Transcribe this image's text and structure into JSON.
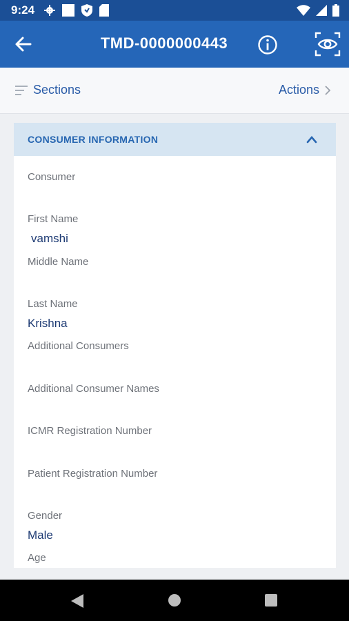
{
  "status_bar": {
    "time": "9:24",
    "left_icons": [
      "gear-icon",
      "square-icon",
      "shield-icon",
      "sd-card-icon"
    ],
    "right_icons": [
      "wifi-icon",
      "signal-icon",
      "battery-icon"
    ]
  },
  "app_bar": {
    "title": "TMD-0000000443",
    "back_icon": "arrow-left-icon",
    "info_icon": "info-icon",
    "preview_icon": "eye-icon"
  },
  "sub_bar": {
    "sections_label": "Sections",
    "actions_label": "Actions"
  },
  "section": {
    "title": "CONSUMER INFORMATION",
    "fields": [
      {
        "label": "Consumer",
        "value": ""
      },
      {
        "label": "First Name",
        "value": "vamshi"
      },
      {
        "label": "Middle Name",
        "value": ""
      },
      {
        "label": "Last Name",
        "value": "Krishna"
      },
      {
        "label": "Additional Consumers",
        "value": ""
      },
      {
        "label": "Additional Consumer Names",
        "value": ""
      },
      {
        "label": "ICMR Registration Number",
        "value": ""
      },
      {
        "label": "Patient Registration Number",
        "value": ""
      },
      {
        "label": "Gender",
        "value": "Male"
      },
      {
        "label": "Age",
        "value": ""
      }
    ]
  },
  "colors": {
    "status_bar": "#1b4f96",
    "app_bar": "#2566b8",
    "section_header_bg": "#d6e5f2",
    "accent_text": "#2766b1",
    "value_text": "#1d3a73"
  }
}
